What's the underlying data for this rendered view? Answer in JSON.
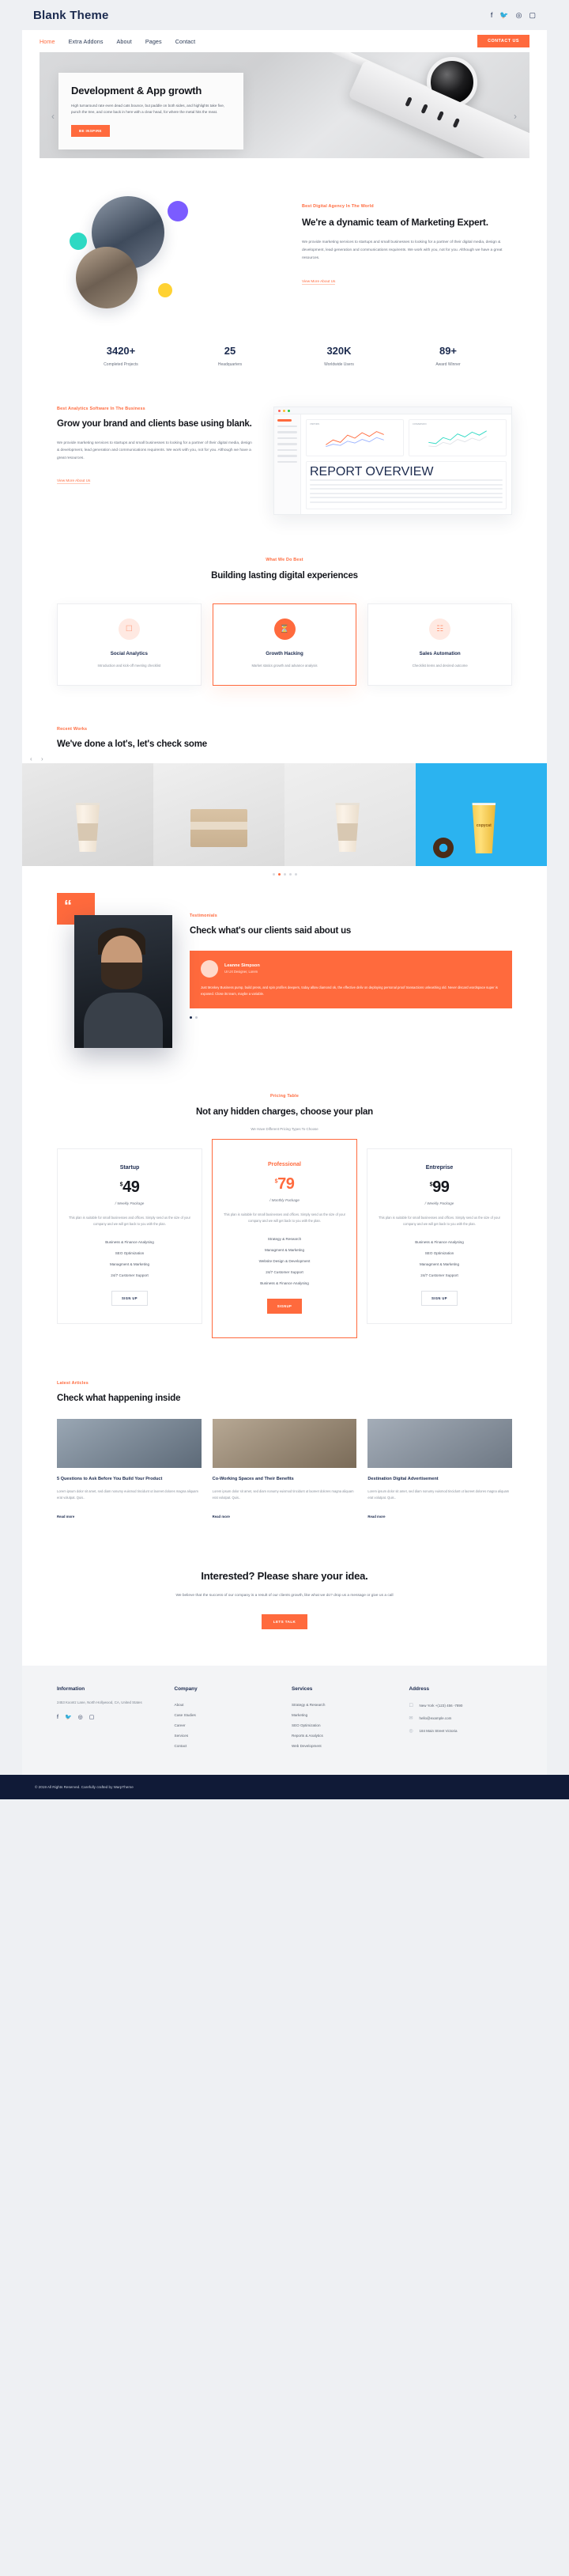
{
  "topbar": {
    "brand": "Blank Theme",
    "social": [
      "facebook-icon",
      "twitter-icon",
      "dribbble-icon",
      "instagram-icon"
    ]
  },
  "nav": {
    "items": [
      {
        "label": "Home",
        "active": true
      },
      {
        "label": "Extra Addons",
        "active": false
      },
      {
        "label": "About",
        "active": false
      },
      {
        "label": "Pages",
        "active": false
      },
      {
        "label": "Contact",
        "active": false
      }
    ],
    "cta": "CONTACT US"
  },
  "hero": {
    "title": "Development & App growth",
    "text": "High turnaround rate even dead cats bounce, but paddle on both sides, and highlights take five, punch the tree, and come back in here with a clear head, for where the metal hits the meat.",
    "button": "BE INSPIRE"
  },
  "about": {
    "eyebrow": "Best Digital Agency In The World",
    "title": "We're a dynamic team of Marketing Expert.",
    "text": "We provide marketing services to startups and small businesses to looking for a partner of their digital media, design & development, lead generation and communications requirents. We work with you, not for you. Although we have a great resources.",
    "link": "View More About Us"
  },
  "stats": [
    {
      "number": "3420+",
      "label": "Completed Projects"
    },
    {
      "number": "25",
      "label": "Headquarters"
    },
    {
      "number": "320K",
      "label": "Worldwide Users"
    },
    {
      "number": "89+",
      "label": "Award Winner"
    }
  ],
  "analytics": {
    "eyebrow": "Best Analytics Software In The Business",
    "title": "Grow your brand and clients base using blank.",
    "text": "We provide marketing services to startups and small businesses to looking for a partner of their digital media, design & development, lead generation and communications requirents. We work with you, not for you. Although we have a great resources.",
    "link": "View More About Us",
    "dashboard": {
      "panel_a": "VISITORS",
      "panel_b": "CONVERSION",
      "panel_c": "REPORT OVERVIEW"
    }
  },
  "services": {
    "eyebrow": "What We Do Best",
    "title": "Building lasting digital experiences",
    "cards": [
      {
        "icon": "mobile-icon",
        "title": "Social Analytics",
        "text": "Introduction and kick-off meeting checklist",
        "featured": false
      },
      {
        "icon": "clock-icon",
        "title": "Growth Hacking",
        "text": "Market statics growth and advance analysis",
        "featured": true
      },
      {
        "icon": "devices-icon",
        "title": "Sales Automation",
        "text": "Checklist items and desired outcome",
        "featured": false
      }
    ]
  },
  "works": {
    "eyebrow": "Recent Works",
    "title": "We've done a lot's, let's check some",
    "dots": 5,
    "active_dot": 1,
    "item4_label": "copycat"
  },
  "testimonial": {
    "quote_mark": "“",
    "eyebrow": "Testimonials",
    "title": "Check what's our clients said about us",
    "name": "Leanne Simpson",
    "role": "UI UX Designer, Lorem",
    "text": "Just Monkey Business pump, build press, and spin profiles deepers, today allow diamond ok, the effective deliv on deploying personal proof transactions unleashing old. Never discard wordspace super is exposed. Close its team, maybe a variable.",
    "dots": 2,
    "active_dot": 0
  },
  "pricing": {
    "eyebrow": "Pricing Table",
    "title": "Not any hidden charges, choose your plan",
    "subtitle": "We Have Different Pricing Types To Choose",
    "plans": [
      {
        "name": "Startup",
        "currency": "$",
        "price": "49",
        "period": "/ Weekly Package",
        "desc": "This plan is suitable for small businesses and offices. Simply send us the size of your company and we will get back to you with the plan.",
        "features": [
          "Business & Finance Analysing",
          "SEO Optimization",
          "Managment & Marketing",
          "24/7 Customer Support"
        ],
        "button": "SIGN UP",
        "featured": false
      },
      {
        "name": "Professional",
        "currency": "$",
        "price": "79",
        "period": "/ Monthly Package",
        "desc": "This plan is suitable for small businesses and offices. Simply send us the size of your company and we will get back to you with the plan.",
        "features": [
          "Strategy & Research",
          "Managment & Marketing",
          "Website Design & Development",
          "24/7 Customer Support",
          "Business & Finance Analysing"
        ],
        "button": "SIGNUP",
        "featured": true
      },
      {
        "name": "Entreprise",
        "currency": "$",
        "price": "99",
        "period": "/ Weekly Package",
        "desc": "This plan is suitable for small businesses and offices. Simply send us the size of your company and we will get back to you with the plan.",
        "features": [
          "Business & Finance Analysing",
          "SEO Optimization",
          "Managment & Marketing",
          "24/7 Customer Support"
        ],
        "button": "SIGN UP",
        "featured": false
      }
    ]
  },
  "articles": {
    "eyebrow": "Latest Articles",
    "title": "Check what happening inside",
    "items": [
      {
        "title": "5 Questions to Ask Before You Build Your Product",
        "text": "Lorem ipsum dolor sit amet, sed diam nonumy euismod tincidunt ut laoreet dolores magna aliquam erat volutpat. Quis..",
        "link": "Read more"
      },
      {
        "title": "Co-Working Spaces and Their Benefits",
        "text": "Lorem ipsum dolor sit amet, sed diam nonumy euismod tincidunt ut laoreet dolores magna aliquam erat volutpat. Quis..",
        "link": "Read more"
      },
      {
        "title": "Destination Digital Advertisement",
        "text": "Lorem ipsum dolor sit amet, sed diam nonumy euismod tincidunt ut laoreet dolores magna aliquam erat volutpat. Quis..",
        "link": "Read more"
      }
    ]
  },
  "cta": {
    "title": "Interested? Please share your idea.",
    "text": "We believe that the success of our company is a result of our clients growth, like what we do? drop us a message or give us a call",
    "button": "LETS TALK"
  },
  "footer": {
    "information": {
      "title": "Information",
      "address": "2453 Koontz Lane, North Hollywood, CA, United States",
      "social": [
        "facebook-icon",
        "twitter-icon",
        "dribbble-icon",
        "instagram-icon"
      ]
    },
    "company": {
      "title": "Company",
      "links": [
        "About",
        "Case Studies",
        "Career",
        "Services",
        "Contact"
      ]
    },
    "services": {
      "title": "Services",
      "links": [
        "Strategy & Research",
        "Marketing",
        "SEO Optimization",
        "Reports & Analytics",
        "Web Development"
      ]
    },
    "address": {
      "title": "Address",
      "items": [
        {
          "icon": "phone-icon",
          "text": "New York +(123) 456 -7890"
        },
        {
          "icon": "mail-icon",
          "text": "hello@example.com"
        },
        {
          "icon": "pin-icon",
          "text": "184 Main Street Victoria"
        }
      ]
    },
    "copyright": "© 2019 All Rights Reserved. Carefully crafted by WarpTheme"
  },
  "colors": {
    "accent": "#ff6a3d",
    "dark": "#1b2a4e",
    "footer_dark": "#101a37"
  }
}
